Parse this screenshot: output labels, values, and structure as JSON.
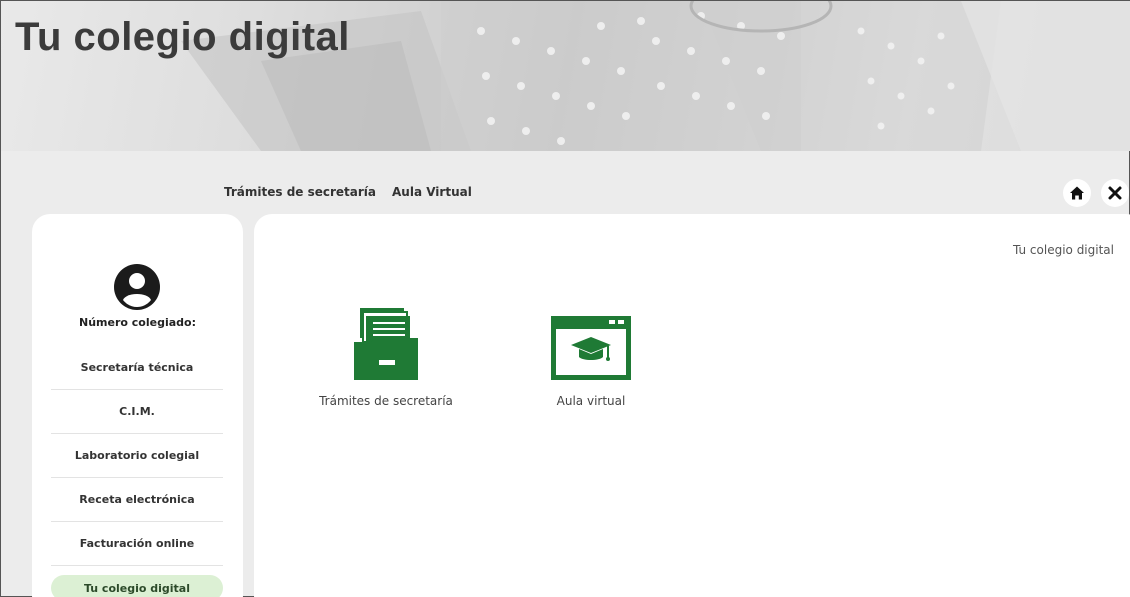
{
  "banner": {
    "title": "Tu colegio digital"
  },
  "top_nav": {
    "items": [
      "Trámites de secretaría",
      "Aula Virtual"
    ]
  },
  "icons": {
    "home": "home-icon",
    "close": "close-icon",
    "user": "user-circle-icon",
    "folder": "document-folder-icon",
    "graduation": "graduation-cap-icon"
  },
  "colors": {
    "accent": "#1f7a35",
    "active_bg": "#dcf0d4"
  },
  "sidebar": {
    "colegiado_label": "Número colegiado:",
    "items": [
      {
        "label": "Secretaría técnica"
      },
      {
        "label": "C.I.M."
      },
      {
        "label": "Laboratorio colegial"
      },
      {
        "label": "Receta electrónica"
      },
      {
        "label": "Facturación online"
      },
      {
        "label": "Tu colegio digital"
      }
    ]
  },
  "main": {
    "breadcrumb": "Tu colegio digital",
    "tiles": [
      {
        "label": "Trámites de secretaría"
      },
      {
        "label": "Aula virtual"
      }
    ]
  }
}
